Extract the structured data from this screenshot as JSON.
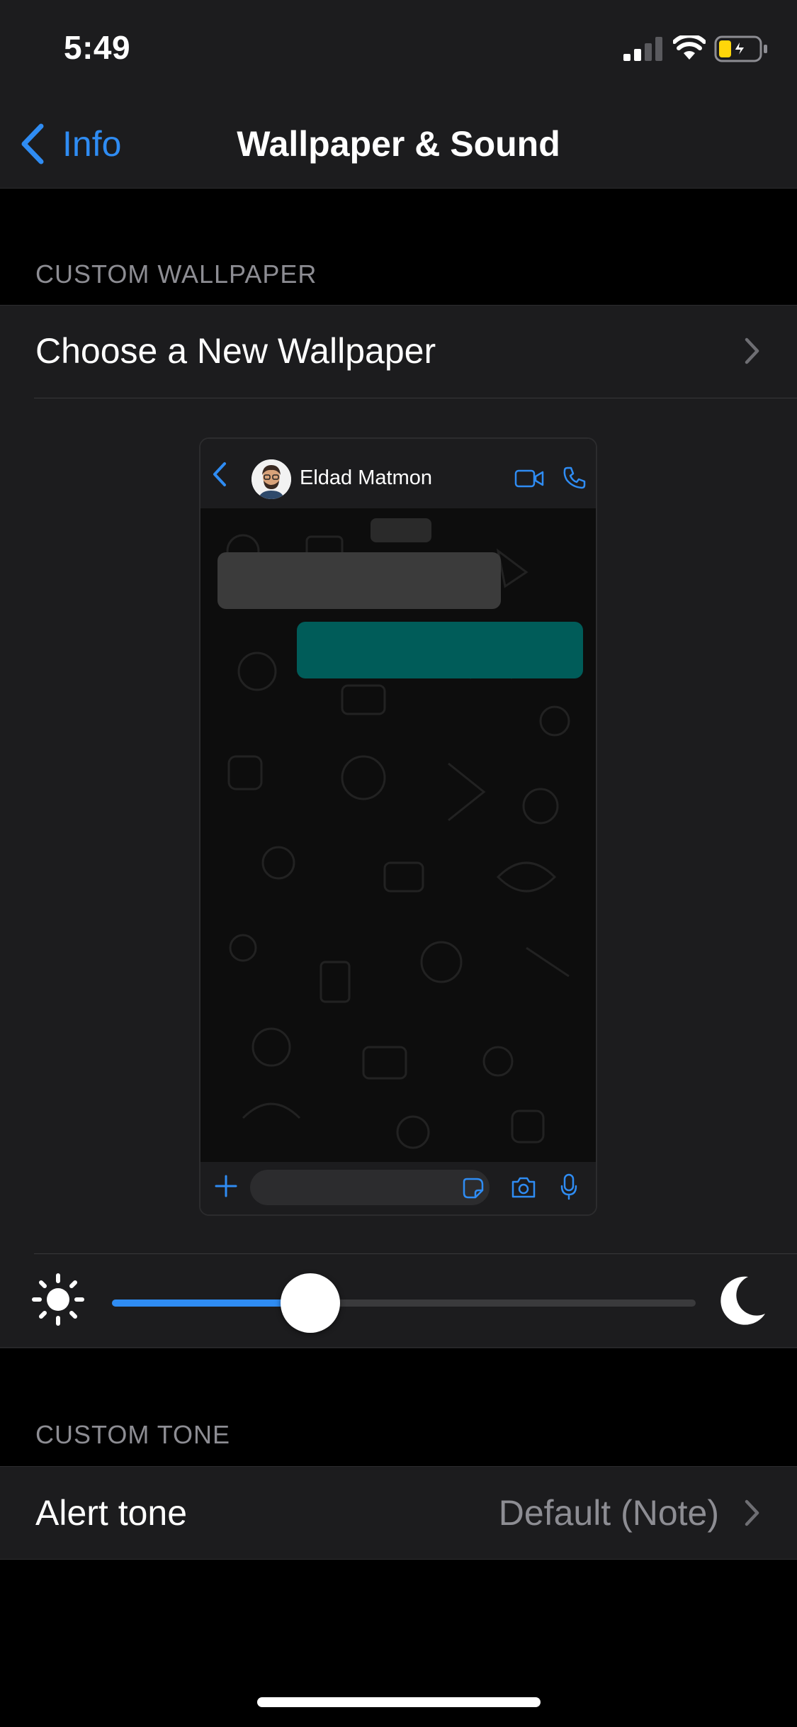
{
  "status_bar": {
    "time": "5:49"
  },
  "nav": {
    "back_label": "Info",
    "title": "Wallpaper & Sound"
  },
  "custom_wallpaper": {
    "header": "CUSTOM WALLPAPER",
    "choose_label": "Choose a New Wallpaper"
  },
  "preview": {
    "contact_name": "Eldad Matmon"
  },
  "brightness": {
    "level": 0.34
  },
  "custom_tone": {
    "header": "CUSTOM TONE",
    "alert_label": "Alert tone",
    "alert_value": "Default (Note)"
  },
  "colors": {
    "accent": "#2f8cf3",
    "background": "#000000",
    "cell_background": "#1c1c1e",
    "secondary_text": "#8d8d93",
    "outgoing_bubble": "#005c59",
    "incoming_bubble": "#3b3b3b",
    "battery_charging": "#ffd60a"
  },
  "icons": {
    "signal": "cellular-signal-icon",
    "wifi": "wifi-icon",
    "battery": "battery-charging-icon",
    "back": "chevron-left-icon",
    "disclosure": "chevron-right-icon",
    "video": "video-camera-icon",
    "call": "phone-icon",
    "attach": "plus-icon",
    "sticker": "sticker-icon",
    "camera": "camera-icon",
    "mic": "microphone-icon",
    "brightness_low": "sun-icon",
    "brightness_dark": "moon-icon"
  }
}
